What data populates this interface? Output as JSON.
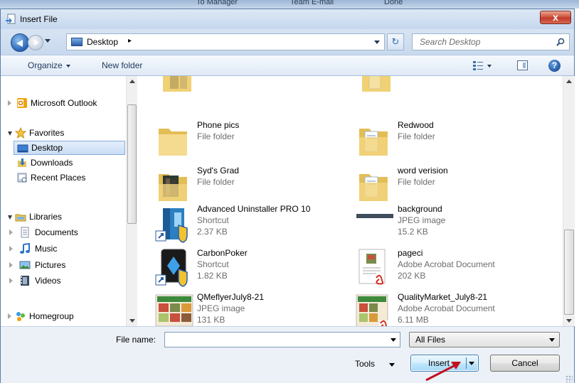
{
  "background_window": {
    "items": [
      "To Manager",
      "Team E-mail",
      "Done"
    ]
  },
  "dialog": {
    "title": "Insert File",
    "close_label": "x",
    "address": {
      "location": "Desktop",
      "separator": "▸"
    },
    "search": {
      "placeholder": "Search Desktop"
    },
    "toolbar": {
      "organize": "Organize",
      "new_folder": "New folder",
      "help": "?"
    },
    "nav": {
      "items": [
        {
          "label": "Microsoft Outlook",
          "icon": "outlook-icon"
        },
        {
          "label": "Favorites",
          "icon": "star-icon"
        },
        {
          "label": "Desktop",
          "icon": "desktop-icon",
          "selected": true
        },
        {
          "label": "Downloads",
          "icon": "downloads-icon"
        },
        {
          "label": "Recent Places",
          "icon": "recent-places-icon"
        },
        {
          "label": "Libraries",
          "icon": "libraries-icon"
        },
        {
          "label": "Documents",
          "icon": "documents-icon"
        },
        {
          "label": "Music",
          "icon": "music-icon"
        },
        {
          "label": "Pictures",
          "icon": "pictures-icon"
        },
        {
          "label": "Videos",
          "icon": "videos-icon"
        },
        {
          "label": "Homegroup",
          "icon": "homegroup-icon"
        }
      ]
    },
    "files": [
      {
        "name": "",
        "type": "File folder",
        "size": "",
        "icon": "folder-icon"
      },
      {
        "name": "",
        "type": "File folder",
        "size": "",
        "icon": "folder-icon"
      },
      {
        "name": "Phone pics",
        "type": "File folder",
        "size": "",
        "icon": "folder-icon"
      },
      {
        "name": "Redwood",
        "type": "File folder",
        "size": "",
        "icon": "folder-icon"
      },
      {
        "name": "Syd's Grad",
        "type": "File folder",
        "size": "",
        "icon": "folder-icon"
      },
      {
        "name": "word verision",
        "type": "File folder",
        "size": "",
        "icon": "folder-icon"
      },
      {
        "name": "Advanced Uninstaller PRO 10",
        "type": "Shortcut",
        "size": "2.37 KB",
        "icon": "app-shortcut-icon"
      },
      {
        "name": "background",
        "type": "JPEG image",
        "size": "15.2 KB",
        "icon": "image-thumbnail-icon"
      },
      {
        "name": "CarbonPoker",
        "type": "Shortcut",
        "size": "1.82 KB",
        "icon": "app-shortcut-icon"
      },
      {
        "name": "pageci",
        "type": "Adobe Acrobat Document",
        "size": "202 KB",
        "icon": "pdf-icon"
      },
      {
        "name": "QMeflyerJuly8-21",
        "type": "JPEG image",
        "size": "131 KB",
        "icon": "flyer-thumbnail-icon"
      },
      {
        "name": "QualityMarket_July8-21",
        "type": "Adobe Acrobat Document",
        "size": "6.11 MB",
        "icon": "pdf-icon"
      }
    ],
    "bottom": {
      "file_name_label": "File name:",
      "file_name_value": "",
      "filter_value": "All Files",
      "tools_label": "Tools",
      "insert_label": "Insert",
      "cancel_label": "Cancel"
    }
  },
  "colors": {
    "accent": "#2663b4",
    "selection": "#c9ddf5",
    "annotation_arrow": "#c1121f"
  }
}
